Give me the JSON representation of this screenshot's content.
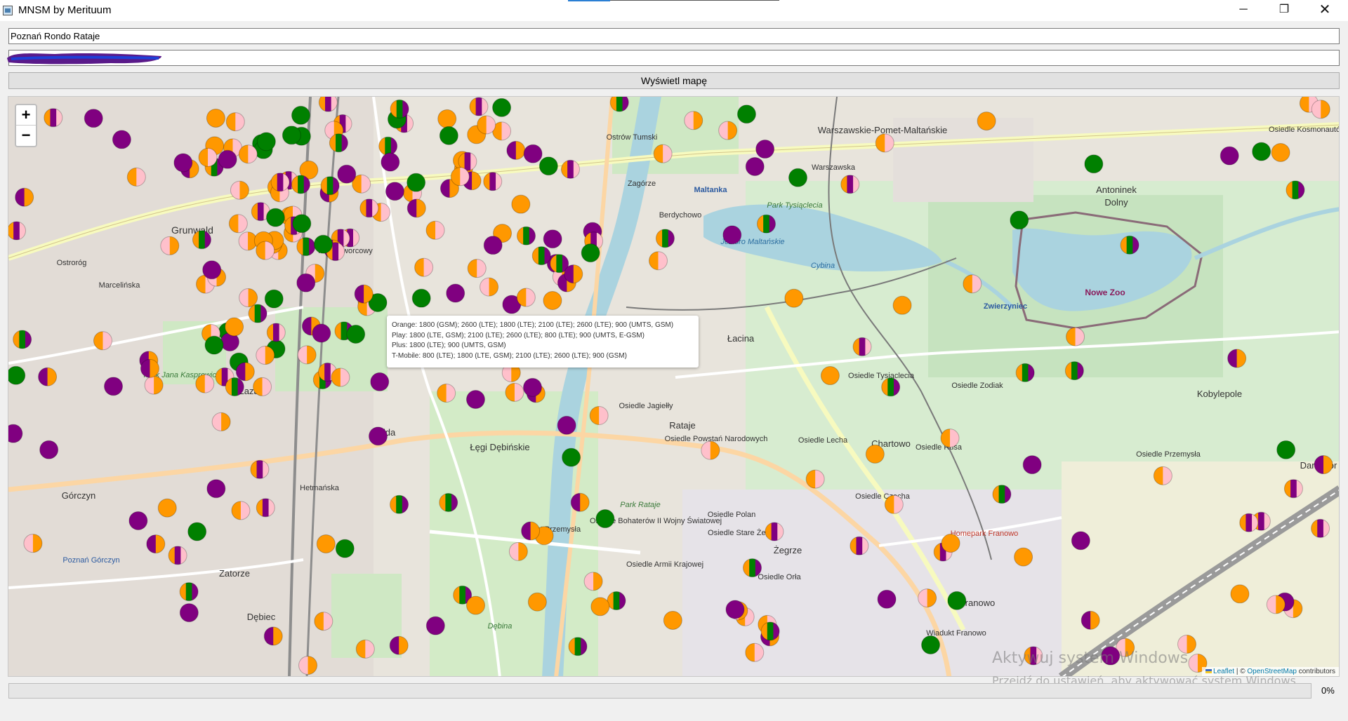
{
  "window": {
    "title": "MNSM by Merituum",
    "minimize_glyph": "─",
    "restore_glyph": "❐",
    "close_glyph": "✕"
  },
  "form": {
    "address_value": "Poznań Rondo Rataje",
    "api_key_value": "",
    "show_map_label": "Wyświetl mapę"
  },
  "map": {
    "zoom_in_label": "+",
    "zoom_out_label": "−",
    "place_labels": [
      "Ostrów Tumski",
      "Zagórze",
      "Warszawskie-Pomet-Maltańskie",
      "Antoninek",
      "Dolny",
      "Maltanka",
      "Berdychowo",
      "Park Tysiąclecia",
      "Jezioro Maltańskie",
      "Cybina",
      "Nowe Zoo",
      "Zwierzyniec",
      "Grunwald",
      "Ostroróg",
      "Most Dworcowy",
      "Łacina",
      "Osiedle Tysiąclecia",
      "Osiedle Zodiak",
      "Kobylepole",
      "Osiedle Jagiełły",
      "Rataje",
      "Osiedle Powstań Narodowych",
      "Osiedle Lecha",
      "Chartowo",
      "Osiedle Rusa",
      "Osiedle Czecha",
      "Łęgi Dębińskie",
      "Wilda",
      "Górczyn",
      "Osiedle Bohaterów II Wojny Światowej",
      "Osiedle Polan",
      "Osiedle Stare Żegrze",
      "Osiedle Armii Krajowej",
      "Osiedle Orła",
      "Żegrze",
      "Franowo",
      "Zatorze",
      "Dębiec",
      "Poznań Górczyn",
      "Park Jana Kasprowicza",
      "Park Rataje",
      "Most Przemysła",
      "Hetmańska",
      "Warszawska",
      "Marcelińska",
      "Osiedle Przemysła",
      "Darzybór",
      "Homepark Franowo",
      "Osiedle Kosmonautów",
      "Wiadukt Franowo",
      "Łazarz",
      "Dębina"
    ],
    "tooltip_lines": [
      "Orange: 1800 (GSM); 2600 (LTE); 1800 (LTE); 2100 (LTE); 2600 (LTE); 900 (UMTS, GSM)",
      "Play: 1800 (LTE, GSM); 2100 (LTE); 2600 (LTE); 800 (LTE); 900 (UMTS, E-GSM)",
      "Plus: 1800 (LTE); 900 (UMTS, GSM)",
      "T-Mobile: 800 (LTE); 1800 (LTE, GSM); 2100 (LTE); 2600 (LTE); 900 (GSM)"
    ],
    "attribution_leaflet": "Leaflet",
    "attribution_sep": " | © ",
    "attribution_osm": "OpenStreetMap",
    "attribution_suffix": " contributors",
    "operator_colors": {
      "orange": "#ff9800",
      "play": "#800080",
      "plus": "#008000",
      "tmobile": "#ffc0cb"
    }
  },
  "watermark": {
    "title": "Aktywuj system Windows",
    "subtitle": "Przejdź do ustawień, aby aktywować system Windows."
  },
  "progress": {
    "value": 0,
    "label": "0%"
  }
}
